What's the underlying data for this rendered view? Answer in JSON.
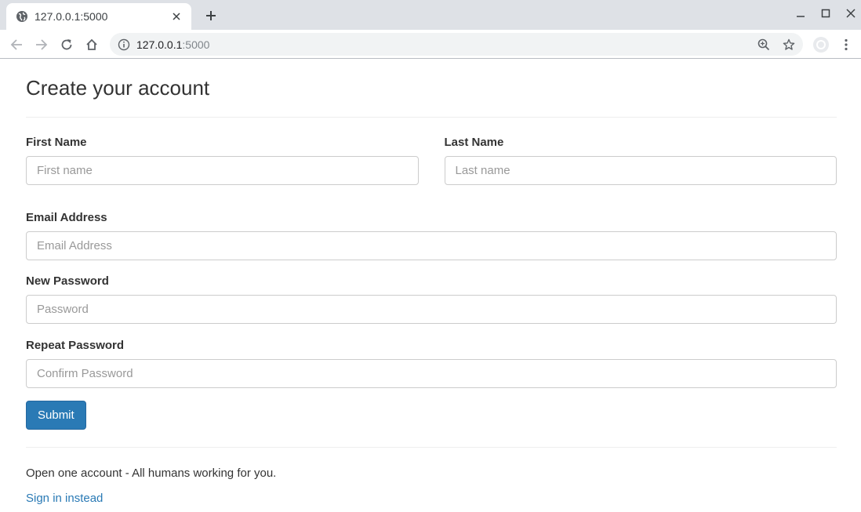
{
  "browser": {
    "tab_title": "127.0.0.1:5000",
    "url_host": "127.0.0.1",
    "url_port": ":5000"
  },
  "form": {
    "heading": "Create your account",
    "first_name": {
      "label": "First Name",
      "placeholder": "First name",
      "value": ""
    },
    "last_name": {
      "label": "Last Name",
      "placeholder": "Last name",
      "value": ""
    },
    "email": {
      "label": "Email Address",
      "placeholder": "Email Address",
      "value": ""
    },
    "password": {
      "label": "New Password",
      "placeholder": "Password",
      "value": ""
    },
    "confirm": {
      "label": "Repeat Password",
      "placeholder": "Confirm Password",
      "value": ""
    },
    "submit_label": "Submit"
  },
  "footer": {
    "tagline": "Open one account - All humans working for you.",
    "signin_link": "Sign in instead"
  },
  "icons": {
    "favicon": "globe-icon",
    "close": "close-icon",
    "new_tab": "plus-icon",
    "back": "arrow-left-icon",
    "forward": "arrow-right-icon",
    "reload": "reload-icon",
    "home": "home-icon",
    "info": "info-icon",
    "zoom": "zoom-icon",
    "bookmark": "star-icon",
    "profile": "avatar-icon",
    "menu": "kebab-menu-icon"
  },
  "colors": {
    "primary": "#2a7ab5",
    "chrome_bg": "#dee1e6"
  }
}
